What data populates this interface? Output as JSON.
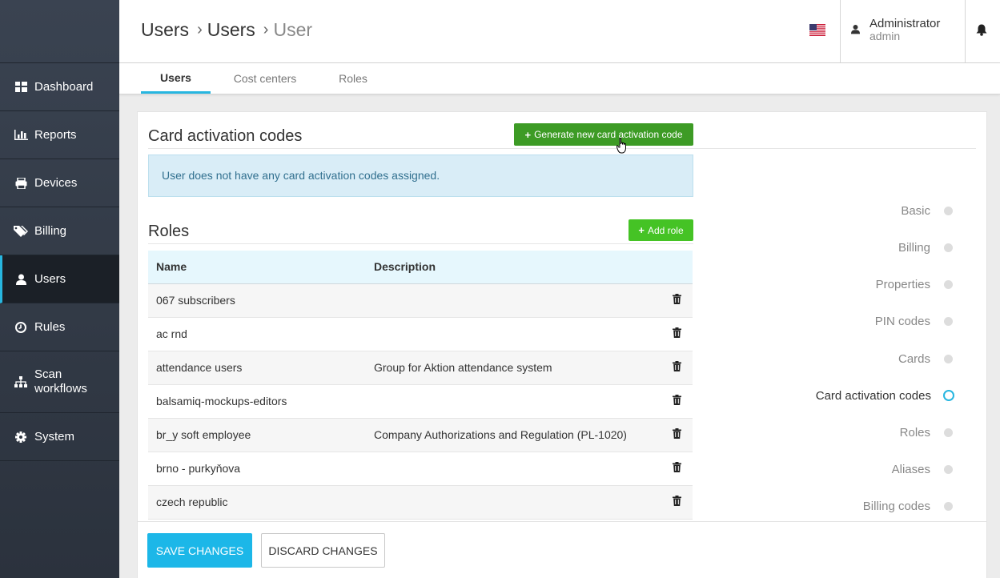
{
  "sidebar": {
    "items": [
      {
        "label": "Dashboard",
        "icon": "dashboard-icon"
      },
      {
        "label": "Reports",
        "icon": "bar-chart-icon"
      },
      {
        "label": "Devices",
        "icon": "printer-icon"
      },
      {
        "label": "Billing",
        "icon": "tags-icon"
      },
      {
        "label": "Users",
        "icon": "user-icon"
      },
      {
        "label": "Rules",
        "icon": "clock-icon"
      },
      {
        "label": "Scan workflows",
        "icon": "sitemap-icon"
      },
      {
        "label": "System",
        "icon": "gear-icon"
      }
    ],
    "active": "Users"
  },
  "header": {
    "breadcrumb": [
      "Users",
      "Users",
      "User"
    ],
    "user_name": "Administrator",
    "user_login": "admin"
  },
  "tabs": [
    {
      "label": "Users",
      "active": true
    },
    {
      "label": "Cost centers",
      "active": false
    },
    {
      "label": "Roles",
      "active": false
    }
  ],
  "card_codes": {
    "title": "Card activation codes",
    "generate_button": "Generate new card activation code",
    "empty_message": "User does not have any card activation codes assigned."
  },
  "roles": {
    "title": "Roles",
    "add_button": "Add role",
    "columns": [
      "Name",
      "Description"
    ],
    "rows": [
      {
        "name": "067 subscribers",
        "description": ""
      },
      {
        "name": "ac rnd",
        "description": ""
      },
      {
        "name": "attendance users",
        "description": "Group for Aktion attendance system"
      },
      {
        "name": "balsamiq-mockups-editors",
        "description": ""
      },
      {
        "name": "br_y soft employee",
        "description": "Company Authorizations and Regulation (PL-1020)"
      },
      {
        "name": "brno - purkyňova",
        "description": ""
      },
      {
        "name": "czech republic",
        "description": ""
      }
    ]
  },
  "section_nav": {
    "items": [
      "Basic",
      "Billing",
      "Properties",
      "PIN codes",
      "Cards",
      "Card activation codes",
      "Roles",
      "Aliases",
      "Billing codes"
    ],
    "active": "Card activation codes"
  },
  "footer": {
    "save_label": "SAVE CHANGES",
    "discard_label": "DISCARD CHANGES"
  },
  "colors": {
    "accent": "#27b6e0",
    "sidebar_bg": "#2f3641",
    "green_button": "#3d9b25",
    "save_button": "#1cb7e8"
  }
}
